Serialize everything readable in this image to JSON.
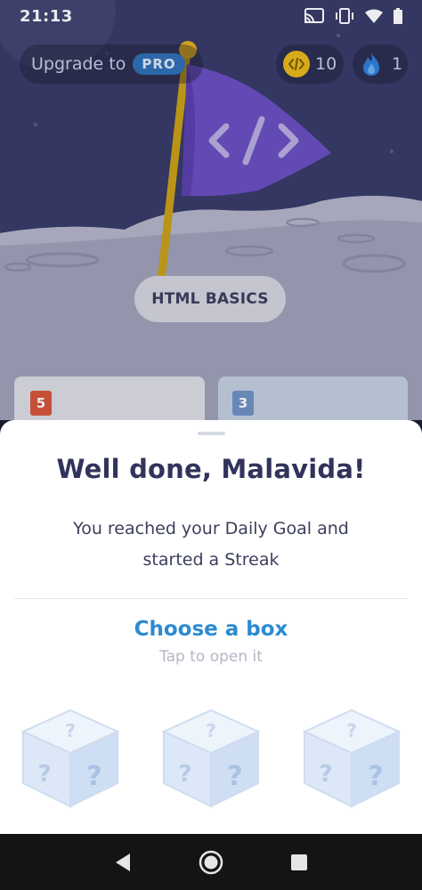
{
  "status_bar": {
    "time": "21:13",
    "icons": [
      "cast-icon",
      "vibrate-icon",
      "wifi-icon",
      "battery-icon"
    ]
  },
  "header": {
    "upgrade_label": "Upgrade to",
    "pro_badge": "PRO",
    "coins_count": "10",
    "streak_count": "1"
  },
  "scene": {
    "lesson_label": "HTML BASICS",
    "flag_icon": "code-icon",
    "cards": [
      {
        "badge": "5",
        "icon": "html5-icon"
      },
      {
        "badge": "3",
        "icon": "css3-icon"
      }
    ]
  },
  "sheet": {
    "title": "Well done, Malavida!",
    "subtitle_line1": "You reached your Daily Goal and",
    "subtitle_line2": "started a Streak",
    "choose_title": "Choose a box",
    "choose_subtitle": "Tap to open it",
    "boxes": [
      "mystery-box",
      "mystery-box",
      "mystery-box"
    ]
  },
  "nav": {
    "buttons": [
      "back-icon",
      "home-icon",
      "recents-icon"
    ]
  },
  "colors": {
    "accent_blue": "#2b8bd1",
    "title_navy": "#31345a",
    "coin_gold": "#e8b81a",
    "flag_purple": "#6a4fc0",
    "pro_blue": "#2f6fb5"
  }
}
